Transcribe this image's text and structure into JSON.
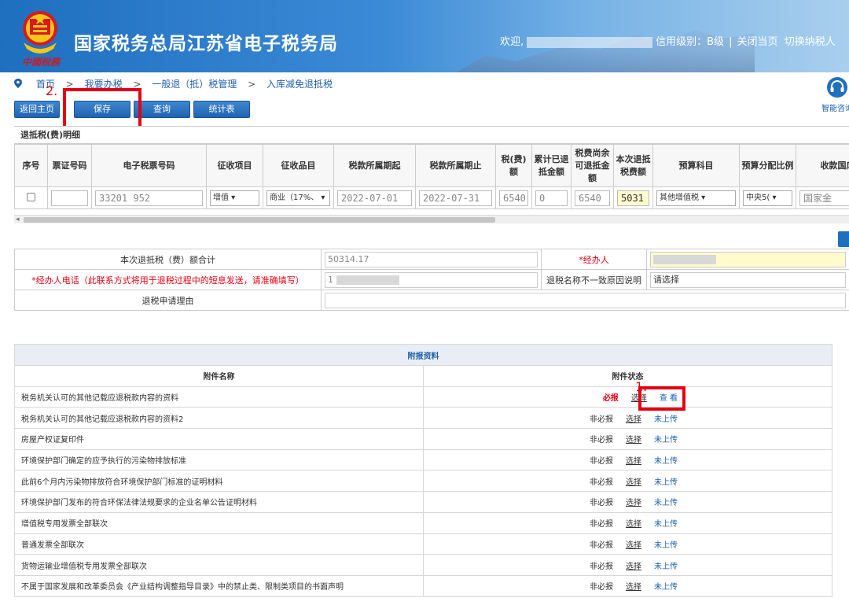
{
  "header": {
    "emblem_caption": "中國稅務",
    "title": "国家税务总局江苏省电子税务局",
    "welcome": "欢迎,",
    "credit_level": "信用级别：B级",
    "close_page": "关闭当页",
    "switch_taxpayer": "切换纳税人"
  },
  "breadcrumb": {
    "items": [
      "首页",
      "我要办税",
      "一般退（抵）税管理",
      "入库减免退抵税"
    ],
    "separator": ">"
  },
  "assist": {
    "label": "智能咨询",
    "icon": "headset-icon"
  },
  "toolbar": {
    "back_home": "返回主页",
    "save": "保存",
    "query": "查询",
    "stats": "统计表"
  },
  "annotations": {
    "step1": "1.",
    "step2": "2."
  },
  "grid": {
    "title": "退抵税(费)明细",
    "columns": [
      "序号",
      "票证号码",
      "电子税票号码",
      "征收项目",
      "征收品目",
      "税款所属期起",
      "税款所属期止",
      "税(费)额",
      "累计已退抵金额",
      "税费尚余可退抵金额",
      "本次退抵税费额",
      "预算科目",
      "预算分配比例",
      "收款国库"
    ],
    "row": {
      "ticket_no": "",
      "e_ticket": "33201 952",
      "levy_item": "增值",
      "levy_subitem": "商业（17%、",
      "period_start": "2022-07-01",
      "period_end": "2022-07-31",
      "tax_amount": "6540",
      "refunded": "0",
      "remaining": "6540",
      "this_refund": "5031",
      "budget_subject": "其他增值税",
      "budget_ratio": "中央5(",
      "treasury": "国家金"
    }
  },
  "summary": {
    "total_label": "本次退抵税（费）额合计",
    "total_value": "50314.17",
    "handler_label": "*经办人",
    "phone_label": "*经办人电话（此联系方式将用于退税过程中的短息发送，请准确填写）",
    "phone_value": "1",
    "mismatch_label": "退税名称不一致原因说明",
    "mismatch_value": "请选择",
    "reason_label": "退税申请理由",
    "reason_value": ""
  },
  "attachments": {
    "title": "附报资料",
    "col_name": "附件名称",
    "col_status": "附件状态",
    "choose_label": "选择",
    "rows": [
      {
        "name": "税务机关认可的其他记载应退税款内容的资料",
        "required": "必报",
        "action": "查  看"
      },
      {
        "name": "税务机关认可的其他记载应退税款内容的资料2",
        "required": "非必报",
        "action": "未上传"
      },
      {
        "name": "房屋产权证复印件",
        "required": "非必报",
        "action": "未上传"
      },
      {
        "name": "环境保护部门确定的应予执行的污染物排放标准",
        "required": "非必报",
        "action": "未上传"
      },
      {
        "name": "此前6个月内污染物排放符合环境保护部门标准的证明材料",
        "required": "非必报",
        "action": "未上传"
      },
      {
        "name": "环境保护部门发布的符合环保法律法规要求的企业名单公告证明材料",
        "required": "非必报",
        "action": "未上传"
      },
      {
        "name": "增值税专用发票全部联次",
        "required": "非必报",
        "action": "未上传"
      },
      {
        "name": "普通发票全部联次",
        "required": "非必报",
        "action": "未上传"
      },
      {
        "name": "货物运输业增值税专用发票全部联次",
        "required": "非必报",
        "action": "未上传"
      },
      {
        "name": "不属于国家发展和改革委员会《产业结构调整指导目录》中的禁止类、限制类项目的书面声明",
        "required": "非必报",
        "action": "未上传"
      }
    ]
  },
  "colors": {
    "brand_blue": "#1f6fc0",
    "highlight_red": "#e60012",
    "required_red": "#e60012",
    "link_blue": "#1d5fae"
  }
}
